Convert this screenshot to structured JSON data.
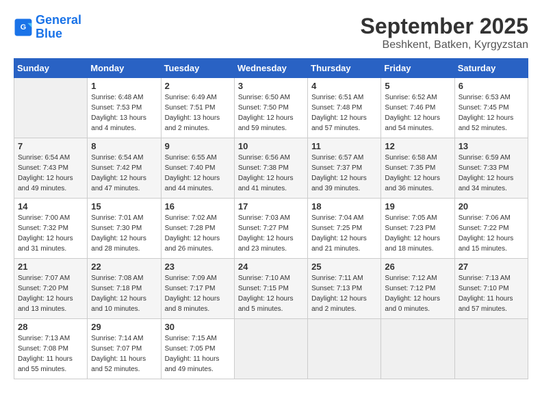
{
  "logo": {
    "line1": "General",
    "line2": "Blue"
  },
  "title": "September 2025",
  "subtitle": "Beshkent, Batken, Kyrgyzstan",
  "headers": [
    "Sunday",
    "Monday",
    "Tuesday",
    "Wednesday",
    "Thursday",
    "Friday",
    "Saturday"
  ],
  "weeks": [
    [
      {
        "day": "",
        "info": ""
      },
      {
        "day": "1",
        "info": "Sunrise: 6:48 AM\nSunset: 7:53 PM\nDaylight: 13 hours\nand 4 minutes."
      },
      {
        "day": "2",
        "info": "Sunrise: 6:49 AM\nSunset: 7:51 PM\nDaylight: 13 hours\nand 2 minutes."
      },
      {
        "day": "3",
        "info": "Sunrise: 6:50 AM\nSunset: 7:50 PM\nDaylight: 12 hours\nand 59 minutes."
      },
      {
        "day": "4",
        "info": "Sunrise: 6:51 AM\nSunset: 7:48 PM\nDaylight: 12 hours\nand 57 minutes."
      },
      {
        "day": "5",
        "info": "Sunrise: 6:52 AM\nSunset: 7:46 PM\nDaylight: 12 hours\nand 54 minutes."
      },
      {
        "day": "6",
        "info": "Sunrise: 6:53 AM\nSunset: 7:45 PM\nDaylight: 12 hours\nand 52 minutes."
      }
    ],
    [
      {
        "day": "7",
        "info": "Sunrise: 6:54 AM\nSunset: 7:43 PM\nDaylight: 12 hours\nand 49 minutes."
      },
      {
        "day": "8",
        "info": "Sunrise: 6:54 AM\nSunset: 7:42 PM\nDaylight: 12 hours\nand 47 minutes."
      },
      {
        "day": "9",
        "info": "Sunrise: 6:55 AM\nSunset: 7:40 PM\nDaylight: 12 hours\nand 44 minutes."
      },
      {
        "day": "10",
        "info": "Sunrise: 6:56 AM\nSunset: 7:38 PM\nDaylight: 12 hours\nand 41 minutes."
      },
      {
        "day": "11",
        "info": "Sunrise: 6:57 AM\nSunset: 7:37 PM\nDaylight: 12 hours\nand 39 minutes."
      },
      {
        "day": "12",
        "info": "Sunrise: 6:58 AM\nSunset: 7:35 PM\nDaylight: 12 hours\nand 36 minutes."
      },
      {
        "day": "13",
        "info": "Sunrise: 6:59 AM\nSunset: 7:33 PM\nDaylight: 12 hours\nand 34 minutes."
      }
    ],
    [
      {
        "day": "14",
        "info": "Sunrise: 7:00 AM\nSunset: 7:32 PM\nDaylight: 12 hours\nand 31 minutes."
      },
      {
        "day": "15",
        "info": "Sunrise: 7:01 AM\nSunset: 7:30 PM\nDaylight: 12 hours\nand 28 minutes."
      },
      {
        "day": "16",
        "info": "Sunrise: 7:02 AM\nSunset: 7:28 PM\nDaylight: 12 hours\nand 26 minutes."
      },
      {
        "day": "17",
        "info": "Sunrise: 7:03 AM\nSunset: 7:27 PM\nDaylight: 12 hours\nand 23 minutes."
      },
      {
        "day": "18",
        "info": "Sunrise: 7:04 AM\nSunset: 7:25 PM\nDaylight: 12 hours\nand 21 minutes."
      },
      {
        "day": "19",
        "info": "Sunrise: 7:05 AM\nSunset: 7:23 PM\nDaylight: 12 hours\nand 18 minutes."
      },
      {
        "day": "20",
        "info": "Sunrise: 7:06 AM\nSunset: 7:22 PM\nDaylight: 12 hours\nand 15 minutes."
      }
    ],
    [
      {
        "day": "21",
        "info": "Sunrise: 7:07 AM\nSunset: 7:20 PM\nDaylight: 12 hours\nand 13 minutes."
      },
      {
        "day": "22",
        "info": "Sunrise: 7:08 AM\nSunset: 7:18 PM\nDaylight: 12 hours\nand 10 minutes."
      },
      {
        "day": "23",
        "info": "Sunrise: 7:09 AM\nSunset: 7:17 PM\nDaylight: 12 hours\nand 8 minutes."
      },
      {
        "day": "24",
        "info": "Sunrise: 7:10 AM\nSunset: 7:15 PM\nDaylight: 12 hours\nand 5 minutes."
      },
      {
        "day": "25",
        "info": "Sunrise: 7:11 AM\nSunset: 7:13 PM\nDaylight: 12 hours\nand 2 minutes."
      },
      {
        "day": "26",
        "info": "Sunrise: 7:12 AM\nSunset: 7:12 PM\nDaylight: 12 hours\nand 0 minutes."
      },
      {
        "day": "27",
        "info": "Sunrise: 7:13 AM\nSunset: 7:10 PM\nDaylight: 11 hours\nand 57 minutes."
      }
    ],
    [
      {
        "day": "28",
        "info": "Sunrise: 7:13 AM\nSunset: 7:08 PM\nDaylight: 11 hours\nand 55 minutes."
      },
      {
        "day": "29",
        "info": "Sunrise: 7:14 AM\nSunset: 7:07 PM\nDaylight: 11 hours\nand 52 minutes."
      },
      {
        "day": "30",
        "info": "Sunrise: 7:15 AM\nSunset: 7:05 PM\nDaylight: 11 hours\nand 49 minutes."
      },
      {
        "day": "",
        "info": ""
      },
      {
        "day": "",
        "info": ""
      },
      {
        "day": "",
        "info": ""
      },
      {
        "day": "",
        "info": ""
      }
    ]
  ]
}
